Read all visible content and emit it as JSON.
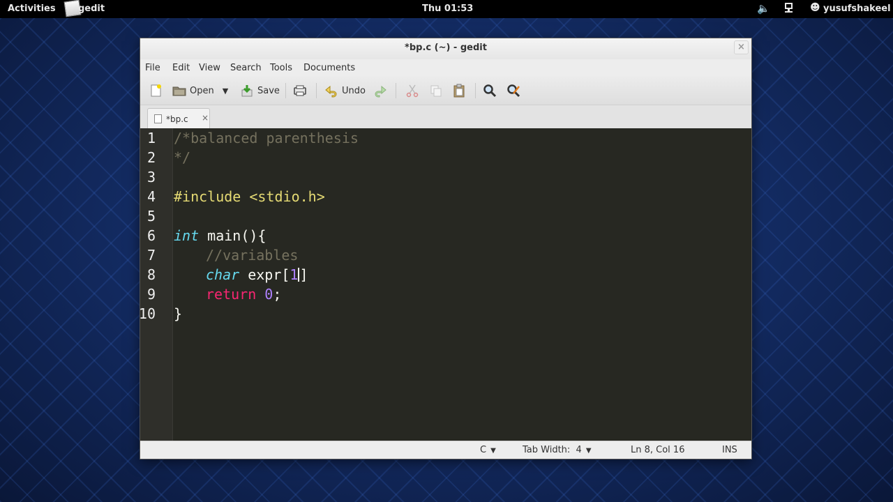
{
  "topbar": {
    "activities": "Activities",
    "app_name": "gedit",
    "clock": "Thu 01:53",
    "user": "yusufshakeel"
  },
  "window": {
    "title": "*bp.c (~) - gedit",
    "close_glyph": "×"
  },
  "menu": [
    "File",
    "Edit",
    "View",
    "Search",
    "Tools",
    "Documents"
  ],
  "toolbar": {
    "open_label": "Open",
    "save_label": "Save",
    "undo_label": "Undo"
  },
  "tab": {
    "label": "*bp.c",
    "close_glyph": "×"
  },
  "editor": {
    "line_numbers": [
      "1",
      "2",
      "3",
      "4",
      "5",
      "6",
      "7",
      "8",
      "9",
      "10"
    ],
    "lines": {
      "l1": "/*balanced parenthesis",
      "l2": "*/",
      "l4_directive": "#include ",
      "l4_header": "<stdio.h>",
      "l6_type": "int",
      "l6_rest": " main(){",
      "l7_comment": "//variables",
      "l8_type": "char",
      "l8_rest": " expr[",
      "l8_num": "1",
      "l8_close": "]",
      "l9_kw": "return",
      "l9_space": " ",
      "l9_num": "0",
      "l9_end": ";",
      "l10": "}"
    }
  },
  "statusbar": {
    "language": "C",
    "tab_width": "Tab Width:  4",
    "position": "Ln 8, Col 16",
    "mode": "INS"
  },
  "colors": {
    "editor_bg": "#272822",
    "comment": "#75715e",
    "string": "#e6db74",
    "keyword": "#f92672",
    "type": "#66d9ef",
    "number": "#ae81ff"
  }
}
